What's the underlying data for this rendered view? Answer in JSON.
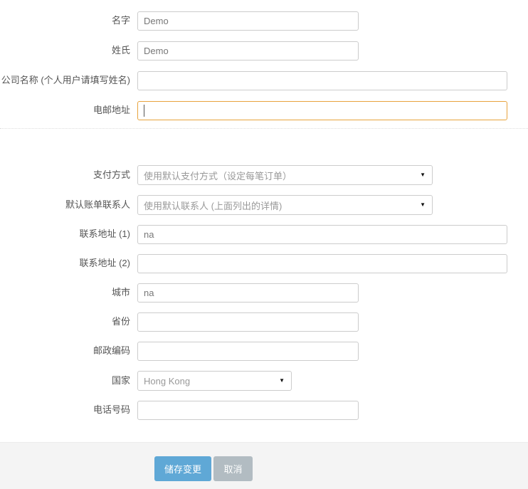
{
  "colors": {
    "accent_blue": "#5fa8d6",
    "cancel_gray": "#b2bcc2",
    "focus_orange": "#e8a33d",
    "footer_bg": "#f4f4f4",
    "input_border": "#cccccc"
  },
  "icons": {
    "dropdown_arrow": "▼"
  },
  "fields": {
    "first_name": {
      "label": "名字",
      "value": "Demo"
    },
    "last_name": {
      "label": "姓氏",
      "value": "Demo"
    },
    "company": {
      "label": "公司名称 (个人用户请填写姓名)",
      "value": ""
    },
    "email": {
      "label": "电邮地址",
      "value": ""
    },
    "payment_method": {
      "label": "支付方式",
      "selected": "使用默认支付方式（设定每笔订单）"
    },
    "billing_contact": {
      "label": "默认账单联系人",
      "selected": "使用默认联系人 (上面列出的详情)"
    },
    "address1": {
      "label": "联系地址 (1)",
      "value": "na"
    },
    "address2": {
      "label": "联系地址 (2)",
      "value": ""
    },
    "city": {
      "label": "城市",
      "value": "na"
    },
    "state": {
      "label": "省份",
      "value": ""
    },
    "postcode": {
      "label": "邮政编码",
      "value": ""
    },
    "country": {
      "label": "国家",
      "selected": "Hong Kong"
    },
    "phone": {
      "label": "电话号码",
      "value": ""
    }
  },
  "buttons": {
    "save": "储存变更",
    "cancel": "取消"
  }
}
